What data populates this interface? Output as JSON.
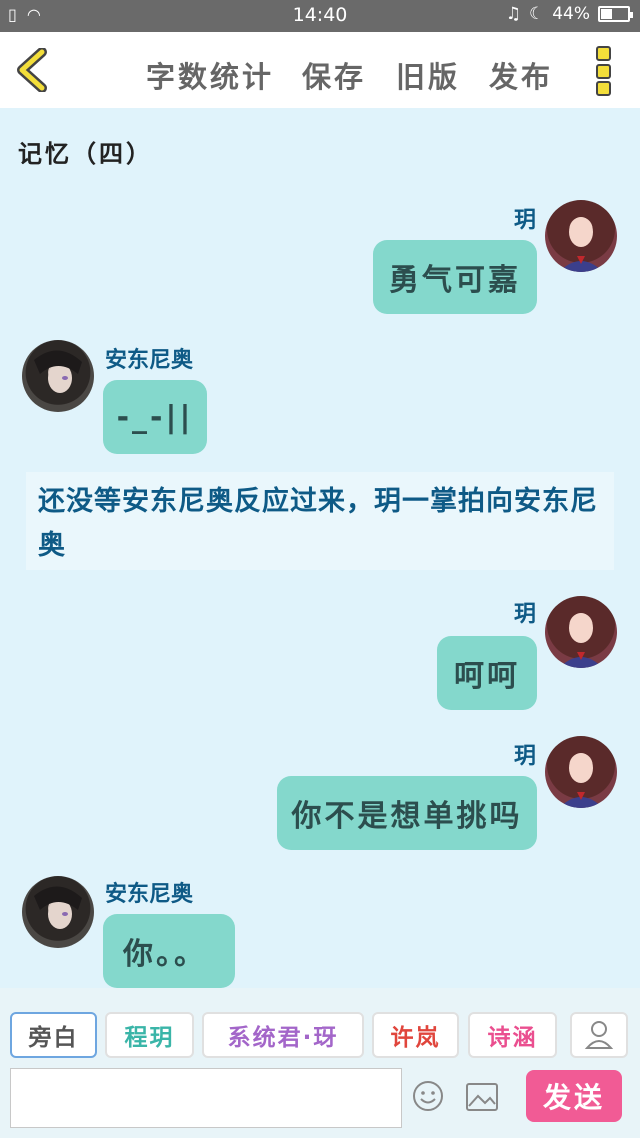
{
  "status_bar": {
    "time": "14:40",
    "battery": "44%",
    "battery_level": 0.44
  },
  "toolbar": {
    "word_count": "字数统计",
    "save": "保存",
    "old_version": "旧版",
    "publish": "发布"
  },
  "chapter_title": "记忆（四）",
  "messages": [
    {
      "speaker": "玥",
      "text": "勇气可嘉"
    },
    {
      "speaker": "安东尼奥",
      "text": "-_-||"
    },
    {
      "narration": "还没等安东尼奥反应过来，玥一掌拍向安东尼奥"
    },
    {
      "speaker": "玥",
      "text": "呵呵"
    },
    {
      "speaker": "玥",
      "text": "你不是想单挑吗"
    },
    {
      "speaker": "安东尼奥",
      "text": "你。。"
    }
  ],
  "role_chips": [
    {
      "label": "旁白",
      "color": "#555555"
    },
    {
      "label": "程玥",
      "color": "#3ab5a8"
    },
    {
      "label": "系统君·玡",
      "color": "#a366c9"
    },
    {
      "label": "许岚",
      "color": "#e0453c"
    },
    {
      "label": "诗涵",
      "color": "#ea4f8f"
    }
  ],
  "composer": {
    "send_label": "发送"
  },
  "icons": {
    "back": "chevron-left-icon",
    "menu": "more-vertical-icon",
    "emoji": "smiley-icon",
    "image": "image-icon",
    "person": "person-icon"
  }
}
